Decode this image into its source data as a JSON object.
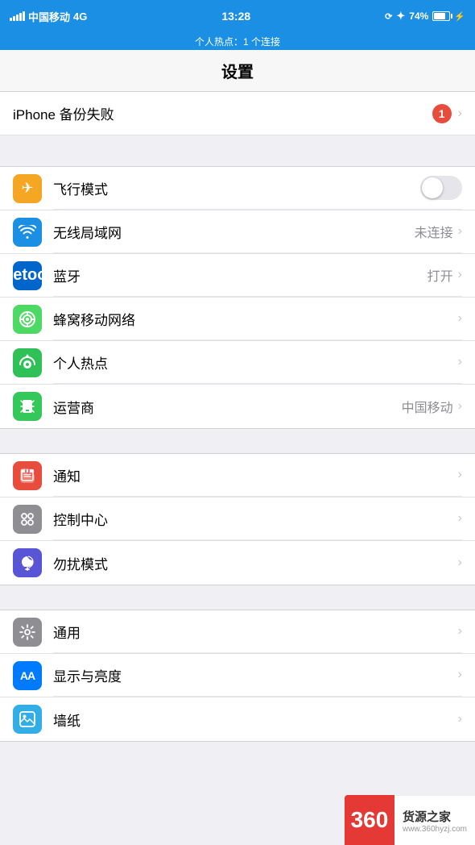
{
  "statusBar": {
    "carrier": "中国移动",
    "network": "4G",
    "time": "13:28",
    "battery": "74%",
    "hotspot": "个人热点：1 个连接"
  },
  "pageTitle": "设置",
  "notification": {
    "label": "iPhone 备份失败",
    "badge": "1"
  },
  "sections": [
    {
      "id": "connectivity",
      "items": [
        {
          "id": "airplane",
          "iconBg": "bg-orange",
          "iconType": "airplane",
          "label": "飞行模式",
          "value": "",
          "hasToggle": true,
          "toggleOn": false,
          "hasChevron": false
        },
        {
          "id": "wifi",
          "iconBg": "bg-blue",
          "iconType": "wifi",
          "label": "无线局域网",
          "value": "未连接",
          "hasToggle": false,
          "toggleOn": false,
          "hasChevron": true
        },
        {
          "id": "bluetooth",
          "iconBg": "bg-blue-dark",
          "iconType": "bluetooth",
          "label": "蓝牙",
          "value": "打开",
          "hasToggle": false,
          "toggleOn": false,
          "hasChevron": true
        },
        {
          "id": "cellular",
          "iconBg": "bg-green-dark",
          "iconType": "cellular",
          "label": "蜂窝移动网络",
          "value": "",
          "hasToggle": false,
          "toggleOn": false,
          "hasChevron": true
        },
        {
          "id": "hotspot",
          "iconBg": "bg-green",
          "iconType": "hotspot",
          "label": "个人热点",
          "value": "",
          "hasToggle": false,
          "toggleOn": false,
          "hasChevron": true
        },
        {
          "id": "carrier",
          "iconBg": "bg-phone-green",
          "iconType": "carrier",
          "label": "运营商",
          "value": "中国移动",
          "hasToggle": false,
          "toggleOn": false,
          "hasChevron": true
        }
      ]
    },
    {
      "id": "notifications",
      "items": [
        {
          "id": "notifications",
          "iconBg": "bg-red",
          "iconType": "notifications",
          "label": "通知",
          "value": "",
          "hasChevron": true
        },
        {
          "id": "control-center",
          "iconBg": "bg-gray",
          "iconType": "control-center",
          "label": "控制中心",
          "value": "",
          "hasChevron": true
        },
        {
          "id": "dnd",
          "iconBg": "bg-purple",
          "iconType": "dnd",
          "label": "勿扰模式",
          "value": "",
          "hasChevron": true
        }
      ]
    },
    {
      "id": "general",
      "items": [
        {
          "id": "general-settings",
          "iconBg": "bg-settings",
          "iconType": "general",
          "label": "通用",
          "value": "",
          "hasChevron": true
        },
        {
          "id": "display",
          "iconBg": "bg-blue2",
          "iconType": "display",
          "label": "显示与亮度",
          "value": "",
          "hasChevron": true
        },
        {
          "id": "wallpaper",
          "iconBg": "bg-teal",
          "iconType": "wallpaper",
          "label": "墙纸",
          "value": "",
          "hasChevron": true
        }
      ]
    }
  ],
  "watermark": {
    "number": "360",
    "label": "货源之家",
    "url": "www.360hyzj.com",
    "com": "COM"
  }
}
